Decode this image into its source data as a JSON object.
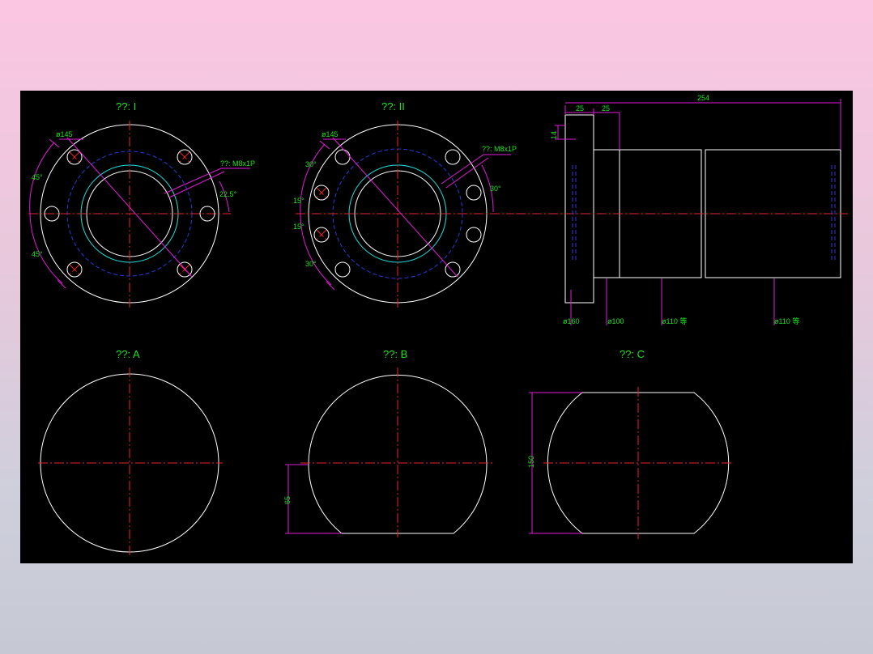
{
  "views": {
    "view_1": {
      "title": "??: I",
      "dia": "ø145",
      "thread": "??: M8x1P",
      "angle_a": "45°",
      "angle_b": "45°",
      "angle_c": "22.5°"
    },
    "view_2": {
      "title": "??: II",
      "dia": "ø145",
      "thread": "??: M8x1P",
      "angle_a": "30°",
      "angle_b": "15°",
      "angle_c": "15°",
      "angle_d": "30°",
      "angle_e": "30°"
    },
    "side": {
      "dim_total": "254",
      "dim_25a": "25",
      "dim_25b": "25",
      "dim_14": "14",
      "d1": "ø160",
      "d2": "ø100",
      "d3": "ø110 等",
      "d4": "ø110 等"
    },
    "view_a": {
      "title": "??: A"
    },
    "view_b": {
      "title": "??: B",
      "dim": "65"
    },
    "view_c": {
      "title": "??: C",
      "dim": "150"
    }
  },
  "colors": {
    "background": "#000000",
    "outline": "#ffffff",
    "centerline": "#e6262b",
    "hidden": "#2a3bd6",
    "dimension": "#e21ad8",
    "text": "#19e419",
    "thread": "#1ee0e0"
  }
}
